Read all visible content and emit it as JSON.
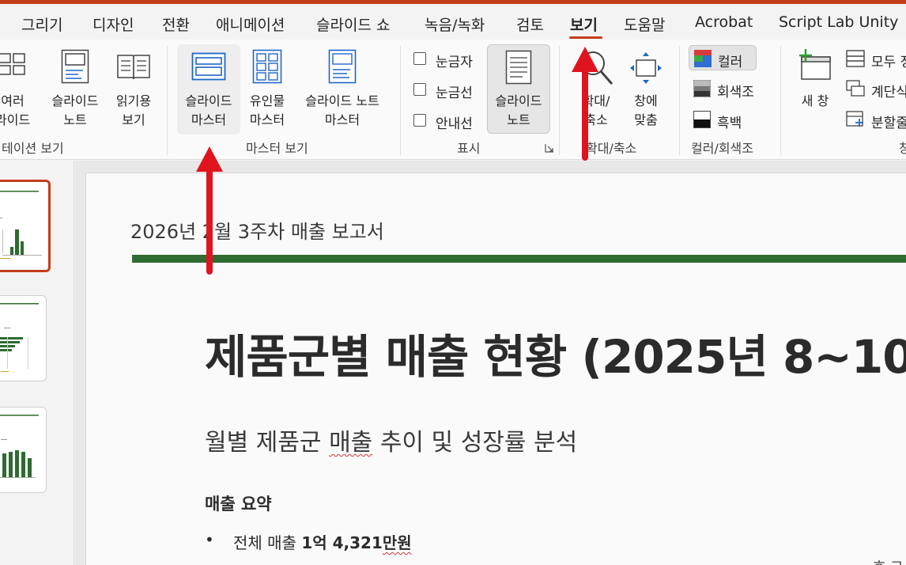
{
  "tabs": [
    {
      "label": "그리기"
    },
    {
      "label": "디자인"
    },
    {
      "label": "전환"
    },
    {
      "label": "애니메이션"
    },
    {
      "label": "슬라이드 쇼"
    },
    {
      "label": "녹음/녹화"
    },
    {
      "label": "검토"
    },
    {
      "label": "보기"
    },
    {
      "label": "도움말"
    },
    {
      "label": "Acrobat"
    },
    {
      "label": "Script Lab Unity"
    }
  ],
  "ribbon": {
    "presentation_views": {
      "group_label": "테이션 보기",
      "multi_slide": {
        "line1": "여러",
        "line2": "라이드"
      },
      "notes_page": {
        "line1": "슬라이드",
        "line2": "노트"
      },
      "reading_view": {
        "line1": "읽기용",
        "line2": "보기"
      }
    },
    "master_views": {
      "group_label": "마스터 보기",
      "slide_master": {
        "line1": "슬라이드",
        "line2": "마스터"
      },
      "handout_master": {
        "line1": "유인물",
        "line2": "마스터"
      },
      "notes_master": {
        "line1": "슬라이드 노트",
        "line2": "마스터"
      }
    },
    "show": {
      "group_label": "표시",
      "ruler": "눈금자",
      "gridlines": "눈금선",
      "guides": "안내선",
      "notes": {
        "line1": "슬라이드",
        "line2": "노트"
      }
    },
    "zoom": {
      "group_label": "확대/축소",
      "zoom": {
        "line1": "확대/",
        "line2": "축소"
      },
      "fit_to_window": {
        "line1": "창에",
        "line2": "맞춤"
      }
    },
    "color": {
      "group_label": "컬러/회색조",
      "color": "컬러",
      "grayscale": "회색조",
      "black_white": "흑백"
    },
    "window": {
      "group_label": "창",
      "new_window": "새 창",
      "arrange_all": "모두 정",
      "cascade": "계단식",
      "split": "분할줄"
    }
  },
  "slide": {
    "header": "2026년 2월 3주차 매출 보고서",
    "title": "제품군별 매출 현황 (2025년 8~10",
    "subtitle_a": "월별 제품군 ",
    "subtitle_b": "매출",
    "subtitle_c": " 추이 및 성장률 분석",
    "section": "매출 요약",
    "bullet_dot": "•",
    "bullet_a": "전체 매출 ",
    "bullet_b": "1억 4,321",
    "bullet_c": "만원",
    "corner_text": "– 효 그"
  },
  "colors": {
    "accent": "#c43e1c",
    "slide_bar": "#2e6b31",
    "arrow": "#e0141e"
  }
}
